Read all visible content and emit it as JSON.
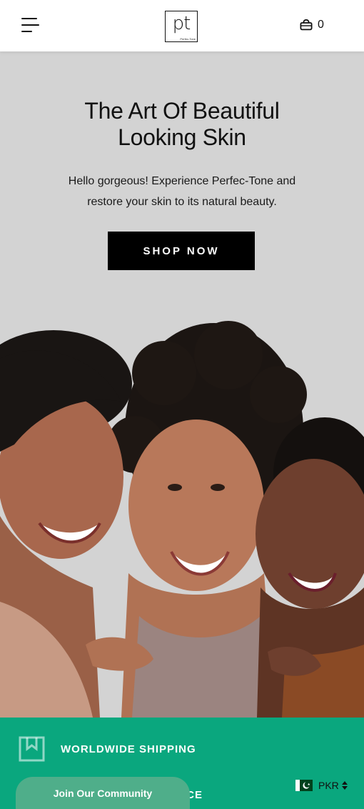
{
  "header": {
    "logo_text": "pt",
    "logo_subtext": "Perfec-Tone",
    "cart_count": "0"
  },
  "hero": {
    "title_line1": "The Art Of Beautiful",
    "title_line2": "Looking Skin",
    "subtitle": "Hello gorgeous! Experience Perfec-Tone and restore your skin to its natural beauty.",
    "cta_label": "SHOP NOW",
    "background_color": "#d3d3d3"
  },
  "features": {
    "background_color": "#0aa77e",
    "items": [
      {
        "label": "WORLDWIDE SHIPPING",
        "icon": "shipping-box-icon"
      },
      {
        "label": "ICE",
        "icon": ""
      }
    ]
  },
  "community": {
    "label": "Join Our Community"
  },
  "currency": {
    "code": "PKR",
    "flag": "pakistan-flag-icon"
  },
  "colors": {
    "accent": "#0aa77e",
    "button": "#000000"
  }
}
